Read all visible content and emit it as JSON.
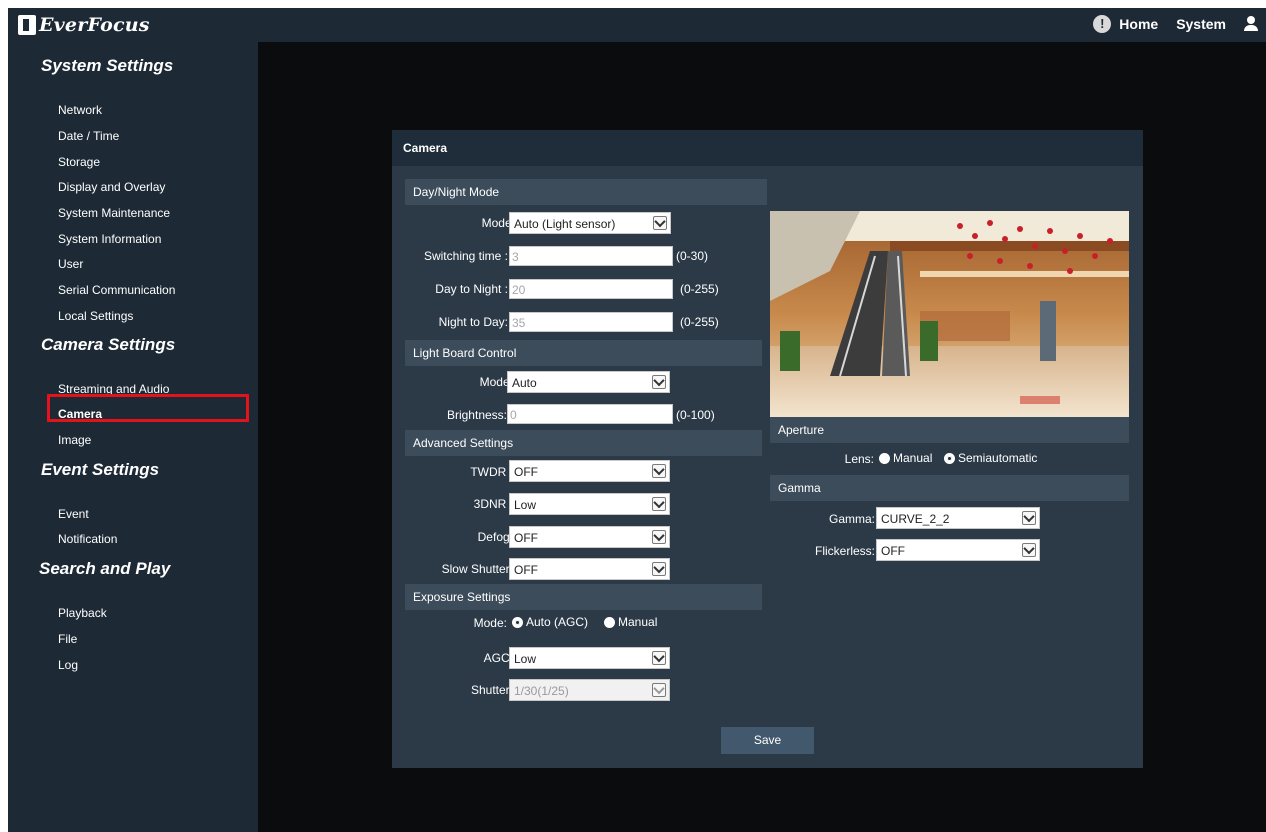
{
  "brand": "EverFocus",
  "topnav": {
    "home": "Home",
    "system": "System"
  },
  "sidebar": {
    "sections": [
      {
        "title": "System Settings",
        "items": [
          "Network",
          "Date / Time",
          "Storage",
          "Display and Overlay",
          "System Maintenance",
          "System Information",
          "User",
          "Serial Communication",
          "Local Settings"
        ]
      },
      {
        "title": "Camera Settings",
        "items": [
          "Streaming and Audio",
          "Camera",
          "Image"
        ]
      },
      {
        "title": "Event Settings",
        "items": [
          "Event",
          "Notification"
        ]
      },
      {
        "title": "Search and Play",
        "items": [
          "Playback",
          "File",
          "Log"
        ]
      }
    ],
    "selected": "Camera"
  },
  "panel": {
    "title": "Camera",
    "day_night": {
      "header": "Day/Night Mode",
      "mode_label": "Mode:",
      "mode_value": "Auto (Light sensor)",
      "switching_label": "Switching time :",
      "switching_value": "3",
      "switching_range": "(0-30)",
      "d2n_label": "Day to Night :",
      "d2n_value": "20",
      "d2n_range": "(0-255)",
      "n2d_label": "Night to Day:",
      "n2d_value": "35",
      "n2d_range": "(0-255)"
    },
    "light_board": {
      "header": "Light Board Control",
      "mode_label": "Mode:",
      "mode_value": "Auto",
      "brightness_label": "Brightness:",
      "brightness_value": "0",
      "brightness_range": "(0-100)"
    },
    "advanced": {
      "header": "Advanced Settings",
      "twdr_label": "TWDR :",
      "twdr_value": "OFF",
      "dnr_label": "3DNR :",
      "dnr_value": "Low",
      "defog_label": "Defog:",
      "defog_value": "OFF",
      "slow_label": "Slow Shutter:",
      "slow_value": "OFF"
    },
    "exposure": {
      "header": "Exposure Settings",
      "mode_label": "Mode:",
      "opt_auto": "Auto (AGC)",
      "opt_manual": "Manual",
      "agc_label": "AGC:",
      "agc_value": "Low",
      "shutter_label": "Shutter:",
      "shutter_value": "1/30(1/25)"
    },
    "aperture": {
      "header": "Aperture",
      "lens_label": "Lens:",
      "opt_manual": "Manual",
      "opt_semi": "Semiautomatic"
    },
    "gamma": {
      "header": "Gamma",
      "gamma_label": "Gamma:",
      "gamma_value": "CURVE_2_2",
      "flicker_label": "Flickerless:",
      "flicker_value": "OFF"
    },
    "save": "Save"
  }
}
